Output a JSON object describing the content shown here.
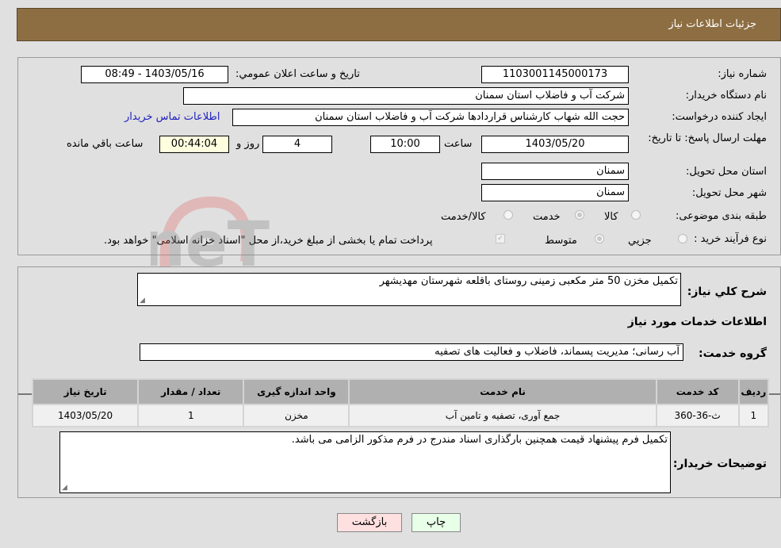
{
  "header": {
    "title": "جزئیات اطلاعات نیاز"
  },
  "form": {
    "need_number_label": "شماره نیاز:",
    "need_number": "1103001145000173",
    "announce_label": "تاريخ و ساعت اعلان عمومي:",
    "announce_value": "1403/05/16 - 08:49",
    "buyer_org_label": "نام دستگاه خريدار:",
    "buyer_org": "شرکت آب و فاضلاب استان سمنان",
    "creator_label": "ايجاد کننده درخواست:",
    "creator": "حجت الله شهاب کارشناس قراردادها شرکت آب و فاضلاب استان سمنان",
    "contact_link": "اطلاعات تماس خريدار",
    "deadline_label": "مهلت ارسال پاسخ: تا تاريخ:",
    "deadline_date": "1403/05/20",
    "time_label": "ساعت",
    "deadline_time": "10:00",
    "days_value": "4",
    "days_label": "روز و",
    "remaining_value": "00:44:04",
    "remaining_label": "ساعت باقي مانده",
    "province_label": "استان محل تحويل:",
    "province": "سمنان",
    "city_label": "شهر محل تحويل:",
    "city": "سمنان",
    "category_label": "طبقه بندی موضوعی:",
    "category_options": [
      "کالا",
      "خدمت",
      "کالا/خدمت"
    ],
    "category_selected": "خدمت",
    "process_label": "نوع فرآيند خريد :",
    "process_options": [
      "جزيي",
      "متوسط"
    ],
    "process_selected": "متوسط",
    "payment_note": "پرداخت تمام يا بخشی از مبلغ خريد،از محل \"اسناد خزانه اسلامی\" خواهد بود."
  },
  "details": {
    "summary_label": "شرح کلي نياز:",
    "summary": "تکمیل مخزن 50 متر مکعبی زمینی روستای باقلعه شهرستان مهدیشهر",
    "services_heading": "اطلاعات خدمات مورد نياز",
    "group_label": "گروه خدمت:",
    "group": "آب رسانی؛ مديريت پسماند، فاضلاب و فعاليت های تصفيه",
    "table": {
      "headers": [
        "رديف",
        "کد خدمت",
        "نام خدمت",
        "واحد اندازه گيری",
        "تعداد / مقدار",
        "تاريخ نياز"
      ],
      "rows": [
        [
          "1",
          "ث-36-360",
          "جمع آوری، تصفيه و تامين آب",
          "مخزن",
          "1",
          "1403/05/20"
        ]
      ]
    },
    "buyer_notes_label": "توضيحات خريدار:",
    "buyer_notes": "تکمیل فرم پیشنهاد قیمت همچنین بارگذاری اسناد مندرج در فرم مذکور الزامی می باشد."
  },
  "buttons": {
    "print": "چاپ",
    "back": "بازگشت"
  },
  "watermark": "AriaTender.neT"
}
